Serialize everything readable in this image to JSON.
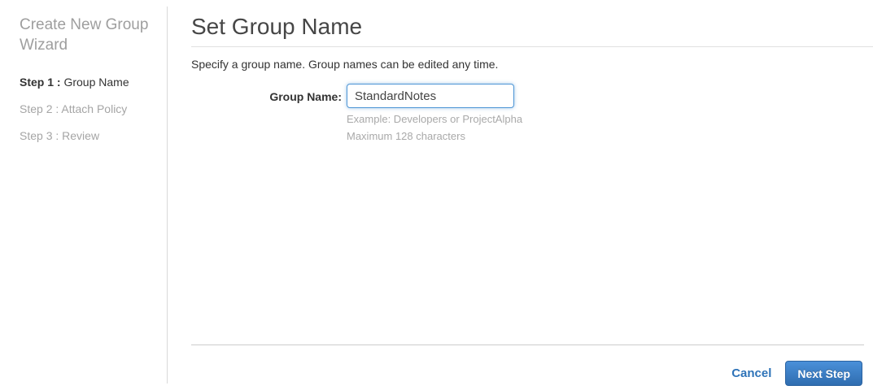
{
  "sidebar": {
    "title": "Create New Group Wizard",
    "steps": [
      {
        "prefix": "Step 1 :",
        "label": " Group Name",
        "active": true
      },
      {
        "prefix": "Step 2 :",
        "label": " Attach Policy",
        "active": false
      },
      {
        "prefix": "Step 3 :",
        "label": " Review",
        "active": false
      }
    ]
  },
  "main": {
    "title": "Set Group Name",
    "description": "Specify a group name. Group names can be edited any time.",
    "form": {
      "label": "Group Name:",
      "value": "StandardNotes",
      "hint_example": "Example: Developers or ProjectAlpha",
      "hint_max": "Maximum 128 characters"
    }
  },
  "footer": {
    "cancel_label": "Cancel",
    "next_label": "Next Step"
  },
  "colors": {
    "accent_blue": "#2e73b8",
    "button_top": "#4a90d9",
    "button_bottom": "#2f6db0",
    "input_focus_border": "#4f96d6",
    "muted_text": "#9e9e9e"
  }
}
